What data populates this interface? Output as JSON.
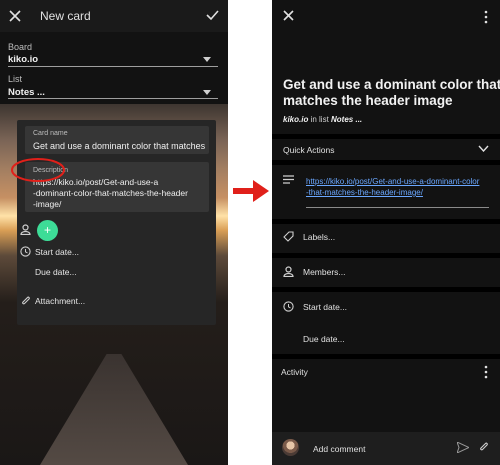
{
  "left": {
    "header": {
      "title": "New card",
      "close_icon": "close-icon",
      "confirm_icon": "check-icon"
    },
    "board": {
      "label": "Board",
      "value": "kiko.io"
    },
    "list": {
      "label": "List",
      "value": "Notes ..."
    },
    "card_name": {
      "label": "Card name",
      "value": "Get and use a dominant color that matches"
    },
    "description": {
      "label": "Description",
      "lines": [
        "https://kiko.io/post/Get-and-use-a",
        "-dominant-color-that-matches-the-header",
        "-image/"
      ]
    },
    "members_add": "+",
    "start_date": "Start date...",
    "due_date": "Due date...",
    "attachment": "Attachment..."
  },
  "right": {
    "title_lines": [
      "Get and use a dominant color that",
      "matches the header image"
    ],
    "subtitle": {
      "board": "kiko.io",
      "mid": " in list ",
      "list": "Notes ..."
    },
    "quick_actions": "Quick Actions",
    "link_lines": [
      "https://kiko.io/post/Get-and-use-a-dominant-color",
      "-that-matches-the-header-image/"
    ],
    "labels": "Labels...",
    "members": "Members...",
    "start_date": "Start date...",
    "due_date": "Due date...",
    "activity": "Activity",
    "add_comment": "Add comment"
  },
  "colors": {
    "highlight_circle": "#e0201a",
    "arrow": "#e0201a",
    "fab": "#3ddc97",
    "link": "#6aa7ff"
  }
}
